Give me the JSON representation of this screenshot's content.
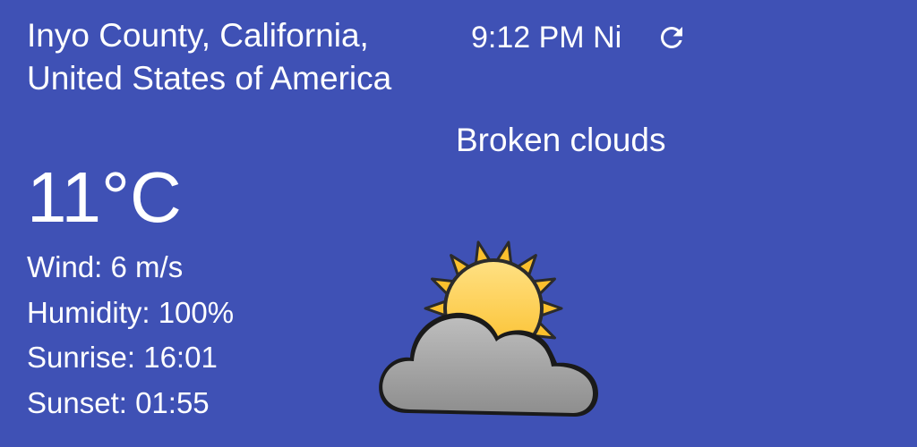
{
  "location": {
    "line1": "Inyo County, California,",
    "line2": "United States of America"
  },
  "last_updated": "9:12 PM Ni",
  "refresh_icon": "refresh-icon",
  "description": "Broken clouds",
  "temperature": "11°C",
  "details": {
    "wind": "Wind: 6 m/s",
    "humidity": "Humidity: 100%",
    "sunrise": "Sunrise: 16:01",
    "sunset": "Sunset: 01:55"
  },
  "weather_icon": "broken-clouds-icon",
  "colors": {
    "background": "#3f51b5",
    "text": "#ffffff",
    "sun": "#fbc02d",
    "cloud": "#a6a6a6"
  }
}
